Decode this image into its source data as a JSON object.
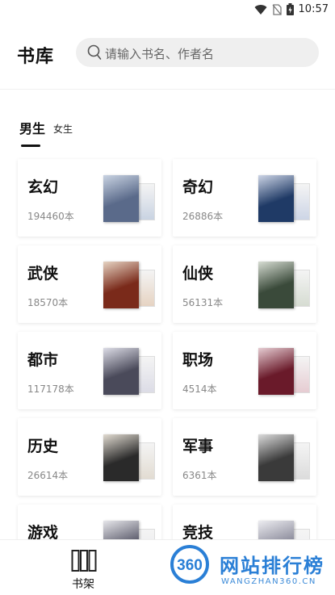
{
  "status": {
    "time": "10:57"
  },
  "header": {
    "title": "书库",
    "search_placeholder": "请输入书名、作者名"
  },
  "tabs": [
    {
      "label": "男生",
      "active": true
    },
    {
      "label": "女生",
      "active": false
    }
  ],
  "categories": [
    {
      "name": "玄幻",
      "count": "194460本",
      "colors": [
        "#5a6a8a",
        "#c9d3e2"
      ]
    },
    {
      "name": "奇幻",
      "count": "26886本",
      "colors": [
        "#1f3a66",
        "#cdd5e6"
      ]
    },
    {
      "name": "武侠",
      "count": "18570本",
      "colors": [
        "#7a2a1a",
        "#e6d3c2"
      ]
    },
    {
      "name": "仙侠",
      "count": "56131本",
      "colors": [
        "#3a4a3a",
        "#d6dcd2"
      ]
    },
    {
      "name": "都市",
      "count": "117178本",
      "colors": [
        "#4a4a5a",
        "#dcdce6"
      ]
    },
    {
      "name": "职场",
      "count": "4514本",
      "colors": [
        "#6a1a2a",
        "#e6ccd2"
      ]
    },
    {
      "name": "历史",
      "count": "26614本",
      "colors": [
        "#2a2a2a",
        "#e2dcd2"
      ]
    },
    {
      "name": "军事",
      "count": "6361本",
      "colors": [
        "#3a3a3a",
        "#dcdcdc"
      ]
    },
    {
      "name": "游戏",
      "count": "",
      "colors": [
        "#5a5a6a",
        "#e6e6ea"
      ]
    },
    {
      "name": "竞技",
      "count": "",
      "colors": [
        "#8a8a9a",
        "#ececf0"
      ]
    }
  ],
  "bottom_nav": {
    "shelf_label": "书架"
  },
  "watermark": {
    "logo": "360",
    "title": "网站排行榜",
    "subtitle": "WANGZHAN360.CN"
  },
  "accent": "#2a7fd6"
}
